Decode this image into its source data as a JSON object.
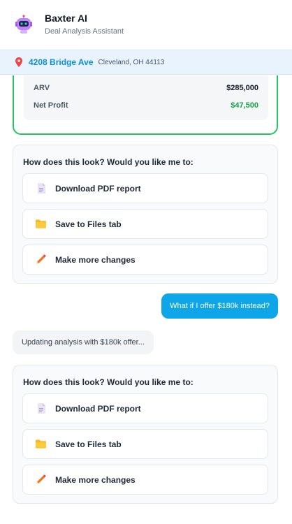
{
  "header": {
    "title": "Baxter AI",
    "subtitle": "Deal Analysis Assistant",
    "avatar_icon": "robot-icon"
  },
  "address": {
    "street": "4208 Bridge Ave",
    "city": "Cleveland, OH 44113",
    "pin_color": "#ef4444"
  },
  "deal_summary": {
    "rows": [
      {
        "label": "ARV",
        "value": "$285,000"
      },
      {
        "label": "Net Profit",
        "value": "$47,500"
      }
    ],
    "accent": "#22c55e"
  },
  "options_prompt_1": {
    "question": "How does this look? Would you like me to:",
    "options": [
      {
        "label": "Download PDF report",
        "icon": "document-icon"
      },
      {
        "label": "Save to Files tab",
        "icon": "folder-icon"
      },
      {
        "label": "Make more changes",
        "icon": "pencil-icon"
      }
    ]
  },
  "user_message": "What if I offer $180k instead?",
  "bot_status": "Updating analysis with $180k offer...",
  "options_prompt_2": {
    "question": "How does this look? Would you like me to:",
    "options": [
      {
        "label": "Download PDF report",
        "icon": "document-icon"
      },
      {
        "label": "Save to Files tab",
        "icon": "folder-icon"
      },
      {
        "label": "Make more changes",
        "icon": "pencil-icon"
      }
    ]
  },
  "colors": {
    "brand_blue": "#0ea5e9",
    "profit_green": "#16a34a"
  }
}
